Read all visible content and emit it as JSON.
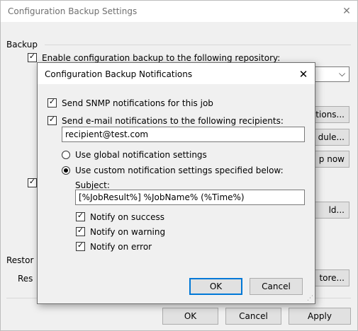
{
  "outer": {
    "title": "Configuration Backup Settings",
    "close_glyph": "✕",
    "backup_group": "Backup",
    "enable_label": "Enable configuration backup to the following repository:",
    "notifications_btn_partial": "ations...",
    "schedule_btn_partial": "dule...",
    "backup_now_btn_partial": "p now",
    "add_btn_partial": "ld...",
    "restore_group_partial": "Restor",
    "restore_label_partial": "Res",
    "restore_btn_partial": "tore...",
    "ok": "OK",
    "cancel": "Cancel",
    "apply": "Apply",
    "dropdown_chevron": "⌵"
  },
  "dialog": {
    "title": "Configuration Backup Notifications",
    "close_glyph": "✕",
    "snmp_label": "Send SNMP notifications for this job",
    "snmp_checked": true,
    "email_label": "Send e-mail notifications to the following recipients:",
    "email_checked": true,
    "recipients_value": "recipient@test.com",
    "use_global_label": "Use global notification settings",
    "use_custom_label": "Use custom notification settings specified below:",
    "selected_option": "custom",
    "subject_label": "Subject:",
    "subject_value": "[%JobResult%] %JobName% (%Time%)",
    "notify_success": "Notify on success",
    "notify_warning": "Notify on warning",
    "notify_error": "Notify on error",
    "ok": "OK",
    "cancel": "Cancel",
    "check_glyph": "✓",
    "grip_glyph": "⋰"
  }
}
